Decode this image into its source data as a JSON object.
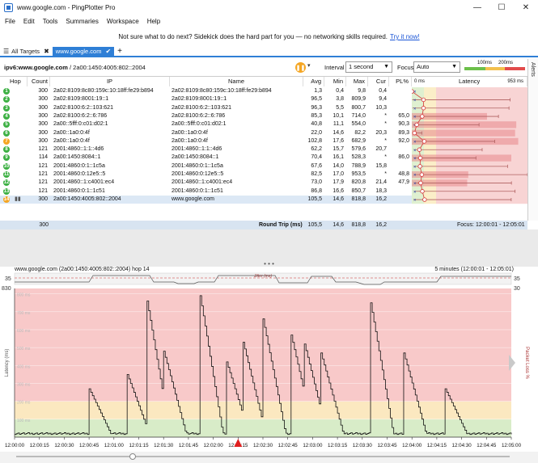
{
  "window": {
    "title": "www.google.com - PingPlotter Pro",
    "minimize": "—",
    "maximize": "☐",
    "close": "✕"
  },
  "menu": [
    "File",
    "Edit",
    "Tools",
    "Summaries",
    "Workspace",
    "Help"
  ],
  "promo": {
    "text": "Not sure what to do next? Sidekick does the hard part for you — no networking skills required.",
    "link": "Try it now!"
  },
  "tabs": {
    "all_targets": "All Targets",
    "active": "www.google.com",
    "add": "+"
  },
  "toolbar": {
    "target_bold": "ipv6:www.google.com",
    "target_rest": " / 2a00:1450:4005:802::2004",
    "interval_label": "Interval",
    "interval_value": "1 second",
    "focus_label": "Focus",
    "focus_value": "Auto",
    "legend_100": "100ms",
    "legend_200": "200ms"
  },
  "alerts_label": "Alerts",
  "grid": {
    "headers": {
      "hop": "Hop",
      "count": "Count",
      "ip": "IP",
      "name": "Name",
      "avg": "Avg",
      "min": "Min",
      "max": "Max",
      "cur": "Cur",
      "pl": "PL%",
      "lat_min": "0 ms",
      "latency": "Latency",
      "lat_max": "953 ms"
    },
    "rows": [
      {
        "hop": "1",
        "count": "300",
        "ip": "2a02:8109:8c80:159c:10:18ff:fe29:b894",
        "name": "2a02:8109:8c80:159c:10:18ff:fe29:b894",
        "avg": "1,3",
        "min": "0,4",
        "max": "9,8",
        "cur": "0,4",
        "pl": "",
        "color": "#3cb043"
      },
      {
        "hop": "2",
        "count": "300",
        "ip": "2a02:8109:8001:19::1",
        "name": "2a02:8109:8001:19::1",
        "avg": "96,5",
        "min": "3,8",
        "max": "809,9",
        "cur": "9,4",
        "pl": "",
        "color": "#3cb043"
      },
      {
        "hop": "3",
        "count": "300",
        "ip": "2a02:8100:6:2::103:621",
        "name": "2a02:8100:6:2::103:621",
        "avg": "96,3",
        "min": "5,5",
        "max": "800,7",
        "cur": "10,3",
        "pl": "",
        "color": "#3cb043"
      },
      {
        "hop": "4",
        "count": "300",
        "ip": "2a02:8100:6:2::6:786",
        "name": "2a02:8100:6:2::6:786",
        "avg": "85,3",
        "min": "10,1",
        "max": "714,0",
        "cur": "*",
        "pl": "65,0",
        "color": "#3cb043"
      },
      {
        "hop": "5",
        "count": "300",
        "ip": "2a00::5fff:0:c01:d02:1",
        "name": "2a00::5fff:0:c01:d02:1",
        "avg": "40,8",
        "min": "11,1",
        "max": "554,0",
        "cur": "*",
        "pl": "90,3",
        "color": "#3cb043"
      },
      {
        "hop": "6",
        "count": "300",
        "ip": "2a00::1a0:0:4f",
        "name": "2a00::1a0:0:4f",
        "avg": "22,0",
        "min": "14,6",
        "max": "82,2",
        "cur": "20,3",
        "pl": "89,3",
        "color": "#3cb043"
      },
      {
        "hop": "7",
        "count": "300",
        "ip": "2a00::1a0:0:4f",
        "name": "2a00::1a0:0:4f",
        "avg": "102,8",
        "min": "17,6",
        "max": "682,9",
        "cur": "*",
        "pl": "92,0",
        "color": "#f5a623"
      },
      {
        "hop": "8",
        "count": "121",
        "ip": "2001:4860::1:1::4d6",
        "name": "2001:4860::1:1::4d6",
        "avg": "62,2",
        "min": "15,7",
        "max": "579,6",
        "cur": "20,7",
        "pl": "",
        "color": "#3cb043"
      },
      {
        "hop": "9",
        "count": "114",
        "ip": "2a00:1450:8084::1",
        "name": "2a00:1450:8084::1",
        "avg": "70,4",
        "min": "16,1",
        "max": "528,3",
        "cur": "*",
        "pl": "86,0",
        "color": "#3cb043"
      },
      {
        "hop": "10",
        "count": "121",
        "ip": "2001:4860:0:1::1c5a",
        "name": "2001:4860:0:1::1c5a",
        "avg": "67,6",
        "min": "14,0",
        "max": "788,9",
        "cur": "15,8",
        "pl": "",
        "color": "#3cb043"
      },
      {
        "hop": "11",
        "count": "121",
        "ip": "2001:4860:0:12e5::5",
        "name": "2001:4860:0:12e5::5",
        "avg": "82,5",
        "min": "17,0",
        "max": "953,5",
        "cur": "*",
        "pl": "48,8",
        "color": "#3cb043"
      },
      {
        "hop": "12",
        "count": "121",
        "ip": "2001:4860::1:c4001:ec4",
        "name": "2001:4860::1:c4001:ec4",
        "avg": "73,0",
        "min": "17,9",
        "max": "820,8",
        "cur": "21,4",
        "pl": "47,9",
        "color": "#3cb043"
      },
      {
        "hop": "13",
        "count": "121",
        "ip": "2001:4860:0:1::1c51",
        "name": "2001:4860:0:1::1c51",
        "avg": "86,8",
        "min": "16,6",
        "max": "850,7",
        "cur": "18,3",
        "pl": "",
        "color": "#3cb043"
      },
      {
        "hop": "14",
        "count": "300",
        "ip": "2a00:1450:4005:802::2004",
        "name": "www.google.com",
        "avg": "105,5",
        "min": "14,6",
        "max": "818,8",
        "cur": "16,2",
        "pl": "",
        "color": "#f5a623"
      }
    ],
    "summary": {
      "count": "300",
      "label": "Round Trip (ms)",
      "avg": "105,5",
      "min": "14,6",
      "max": "818,8",
      "cur": "16,2",
      "focus": "Focus: 12:00:01 - 12:05:01"
    }
  },
  "graph": {
    "title": "www.google.com (2a00:1450:4005:802::2004) hop 14",
    "range": "5 minutes (12:00:01 - 12:05:01)",
    "y_top": "830",
    "jitter_label": "Jitter (ms)",
    "jitter_35_left": "35",
    "jitter_35_right": "35",
    "y_axis_label": "Latency (ms)",
    "right_axis_label": "Packet Loss %",
    "right_top": "30",
    "y_ticks": [
      "800 ms",
      "700 ms",
      "600 ms",
      "500 ms",
      "400 ms",
      "300 ms",
      "200 ms",
      "100 ms"
    ],
    "x_ticks": [
      "12:00:00",
      "12:00:15",
      "12:00:30",
      "12:00:45",
      "12:01:00",
      "12:01:15",
      "12:01:30",
      "12:01:45",
      "12:02:00",
      "12:02:15",
      "12:02:30",
      "12:02:45",
      "12:03:00",
      "12:03:15",
      "12:03:30",
      "12:03:45",
      "12:04:00",
      "12:04:15",
      "12:04:30",
      "12:04:45",
      "12:05:00"
    ]
  },
  "chart_data": {
    "type": "line",
    "ylabel": "Latency (ms)",
    "ylim": [
      0,
      830
    ],
    "xlabel": "",
    "x_range": [
      "12:00:00",
      "12:05:00"
    ],
    "series": [
      {
        "name": "",
        "spikes": [
          {
            "t": "12:00:45",
            "peak": 270
          },
          {
            "t": "12:01:08",
            "peak": 350
          },
          {
            "t": "12:01:20",
            "peak": 760
          },
          {
            "t": "12:01:30",
            "peak": 480
          },
          {
            "t": "12:01:52",
            "peak": 790
          },
          {
            "t": "12:02:08",
            "peak": 420
          },
          {
            "t": "12:02:18",
            "peak": 530
          },
          {
            "t": "12:02:30",
            "peak": 660
          },
          {
            "t": "12:02:47",
            "peak": 570
          },
          {
            "t": "12:02:55",
            "peak": 520
          },
          {
            "t": "12:03:05",
            "peak": 470
          },
          {
            "t": "12:03:35",
            "peak": 750
          },
          {
            "t": "12:03:55",
            "peak": 470
          },
          {
            "t": "12:04:20",
            "peak": 270
          }
        ],
        "baseline_ms": 20
      }
    ],
    "grid": true,
    "bands": [
      {
        "from": 0,
        "to": 100,
        "color": "#d8ecc8"
      },
      {
        "from": 100,
        "to": 200,
        "color": "#fbe8c0"
      },
      {
        "from": 200,
        "to": 830,
        "color": "#f8c9c9"
      }
    ]
  }
}
